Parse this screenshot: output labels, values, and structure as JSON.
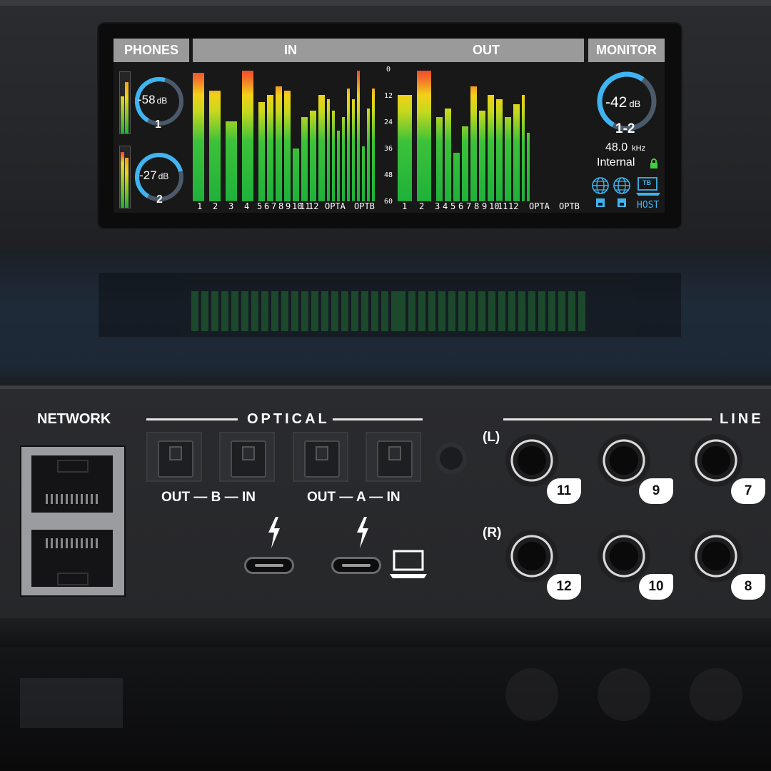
{
  "display": {
    "headers": {
      "phones": "PHONES",
      "in": "IN",
      "out": "OUT",
      "monitor": "MONITOR"
    },
    "phones": [
      {
        "value": "-58",
        "unit": "dB",
        "channel": "1",
        "level": 0.55
      },
      {
        "value": "-27",
        "unit": "dB",
        "channel": "2",
        "level": 0.75
      }
    ],
    "scale_ticks": [
      "0",
      "12",
      "24",
      "36",
      "48",
      "60"
    ],
    "in_labels": [
      "1",
      "2",
      "3",
      "4",
      "5",
      "6",
      "7",
      "8",
      "9",
      "10",
      "11",
      "12",
      "OPTA",
      "OPTB"
    ],
    "out_labels": [
      "1",
      "2",
      "3",
      "4",
      "5",
      "6",
      "7",
      "8",
      "9",
      "10",
      "11",
      "12",
      "OPTA",
      "OPTB"
    ],
    "in_levels_db": [
      -2,
      -10,
      -24,
      -1,
      -15,
      -12,
      -8,
      -10,
      -36,
      -22,
      -19,
      -12,
      -14,
      -19,
      -28,
      -22,
      -9,
      -14,
      -1,
      -35,
      -18,
      -9
    ],
    "out_levels_db": [
      -12,
      -1,
      -22,
      -18,
      -38,
      -26,
      -8,
      -19,
      -12,
      -14,
      -22,
      -16,
      -12,
      -29
    ],
    "monitor": {
      "value": "-42",
      "unit": "dB",
      "channel": "1-2",
      "sample_rate": "48.0",
      "sample_rate_unit": "kHz",
      "clock": "Internal",
      "host_label": "HOST",
      "tb_label": "TB",
      "level": 0.62
    },
    "colors": {
      "accent": "#3fb4f0",
      "meter_green": "#1fb13a",
      "meter_yellow": "#f2d019",
      "meter_red": "#f2402a",
      "lock": "#3ed23a"
    }
  },
  "rear": {
    "network_label": "NETWORK",
    "optical_label": "OPTICAL",
    "line_label": "LINE",
    "optical_b_caption": {
      "out": "OUT",
      "port": "B",
      "in": "IN"
    },
    "optical_a_caption": {
      "out": "OUT",
      "port": "A",
      "in": "IN"
    },
    "line_left_label": "(L)",
    "line_right_label": "(R)",
    "line_top_numbers": [
      "11",
      "9",
      "7"
    ],
    "line_bottom_numbers": [
      "12",
      "10",
      "8"
    ]
  }
}
